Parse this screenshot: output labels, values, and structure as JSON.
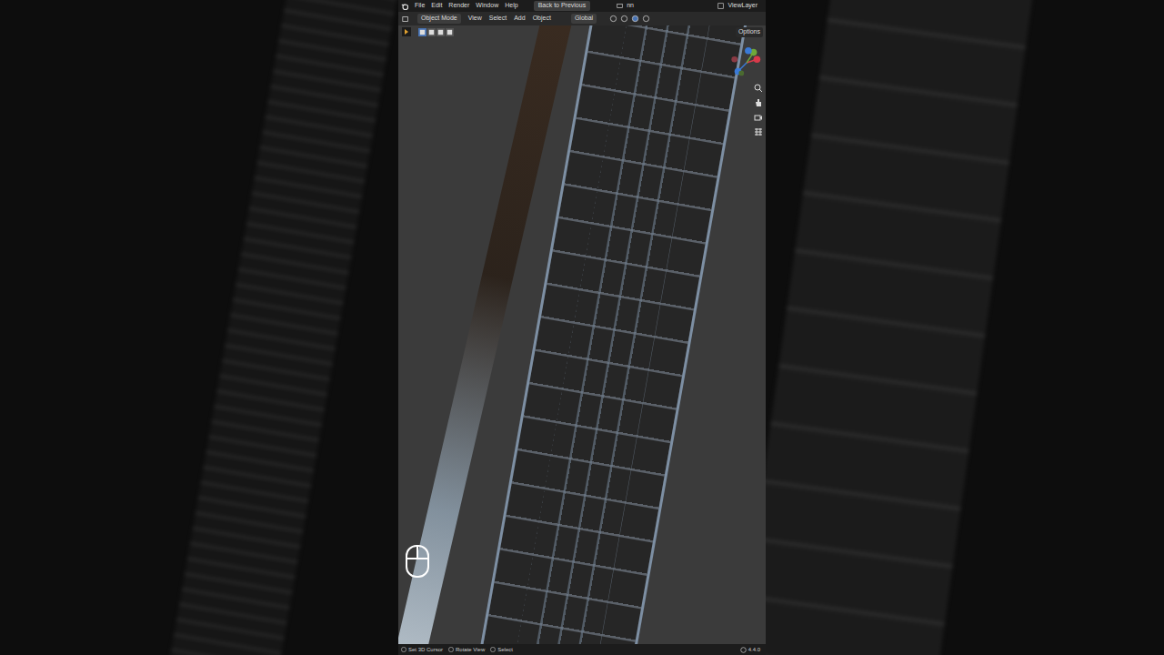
{
  "menu_bar": {
    "items": [
      "File",
      "Edit",
      "Render",
      "Window",
      "Help"
    ],
    "back_button": "Back to Previous",
    "scene": "nn",
    "view_layer": "ViewLayer"
  },
  "header": {
    "mode": "Object Mode",
    "menus": [
      "View",
      "Select",
      "Add",
      "Object"
    ],
    "orientation": "Global",
    "options": "Options"
  },
  "status_bar": {
    "hints": [
      "Set 3D Cursor",
      "Rotate View",
      "Select"
    ],
    "version": "4.4.0"
  }
}
